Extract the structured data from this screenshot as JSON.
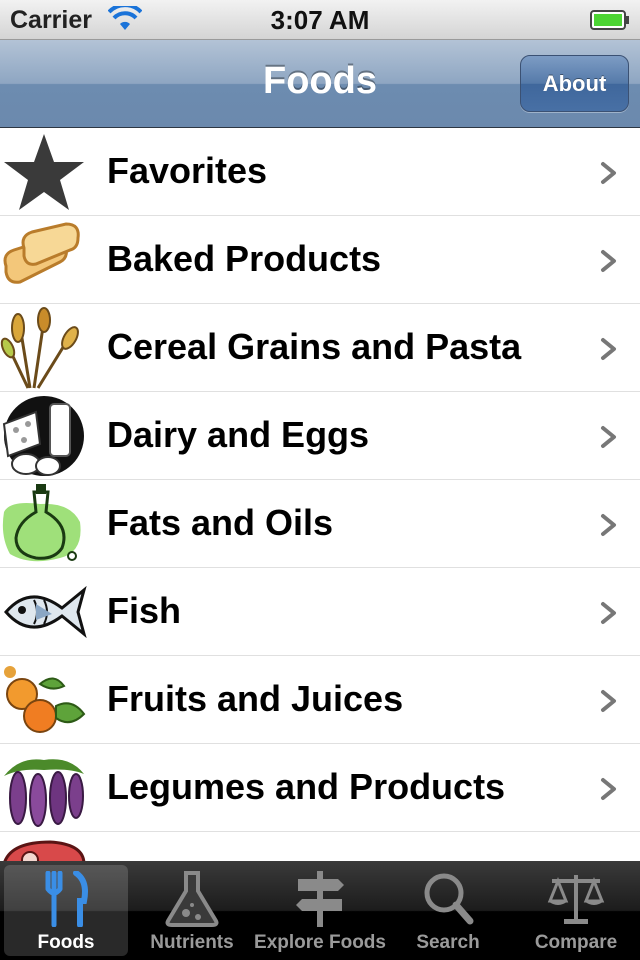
{
  "status_bar": {
    "carrier": "Carrier",
    "time": "3:07 AM"
  },
  "nav": {
    "title": "Foods",
    "about_label": "About"
  },
  "list": {
    "items": [
      {
        "label": "Favorites",
        "icon": "star-icon"
      },
      {
        "label": "Baked Products",
        "icon": "bread-icon"
      },
      {
        "label": "Cereal Grains and Pasta",
        "icon": "wheat-icon"
      },
      {
        "label": "Dairy and Eggs",
        "icon": "dairy-icon"
      },
      {
        "label": "Fats and Oils",
        "icon": "oil-bottle-icon"
      },
      {
        "label": "Fish",
        "icon": "fish-icon"
      },
      {
        "label": "Fruits and Juices",
        "icon": "fruit-icon"
      },
      {
        "label": "Legumes and Products",
        "icon": "legumes-icon"
      },
      {
        "label": "",
        "icon": "meat-icon"
      }
    ]
  },
  "tabs": [
    {
      "label": "Foods",
      "icon": "fork-knife-icon",
      "active": true
    },
    {
      "label": "Nutrients",
      "icon": "flask-icon",
      "active": false
    },
    {
      "label": "Explore Foods",
      "icon": "signpost-icon",
      "active": false
    },
    {
      "label": "Search",
      "icon": "magnifier-icon",
      "active": false
    },
    {
      "label": "Compare",
      "icon": "scales-icon",
      "active": false
    }
  ],
  "colors": {
    "nav_accent": "#6d8cb0",
    "tab_active_icon": "#3a8ee6",
    "battery": "#4cd433"
  }
}
